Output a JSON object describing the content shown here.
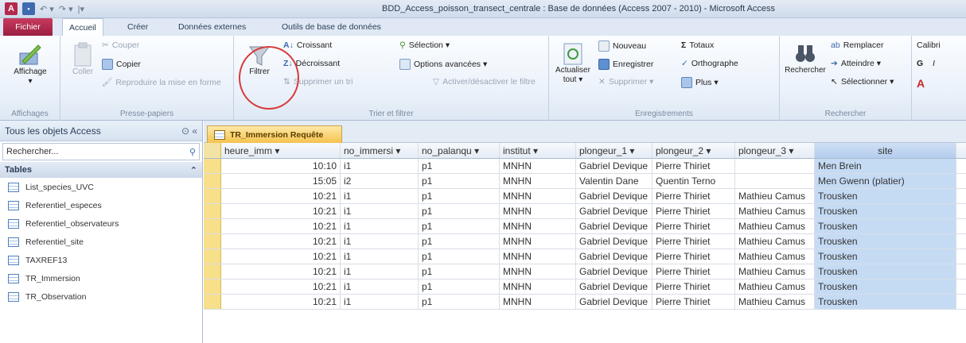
{
  "window": {
    "title": "BDD_Access_poisson_transect_centrale : Base de données (Access 2007 - 2010) - Microsoft Access"
  },
  "ribbon_tabs": [
    "Fichier",
    "Accueil",
    "Créer",
    "Données externes",
    "Outils de base de données"
  ],
  "ribbon": {
    "affichages": {
      "view_label": "Affichage",
      "group_label": "Affichages"
    },
    "clipboard": {
      "paste_label": "Coller",
      "cut_label": "Couper",
      "copy_label": "Copier",
      "format_painter_label": "Reproduire la mise en forme",
      "group_label": "Presse-papiers"
    },
    "sort_filter": {
      "filter_label": "Filtrer",
      "asc_label": "Croissant",
      "desc_label": "Décroissant",
      "remove_sort_label": "Supprimer un tri",
      "selection_label": "Sélection ▾",
      "advanced_label": "Options avancées ▾",
      "toggle_filter_label": "Activer/désactiver le filtre",
      "group_label": "Trier et filtrer"
    },
    "records": {
      "refresh_label": "Actualiser tout ▾",
      "new_label": "Nouveau",
      "save_label": "Enregistrer",
      "delete_label": "Supprimer ▾",
      "totals_label": "Totaux",
      "spelling_label": "Orthographe",
      "more_label": "Plus ▾",
      "group_label": "Enregistrements"
    },
    "find": {
      "find_label": "Rechercher",
      "replace_label": "Remplacer",
      "goto_label": "Atteindre ▾",
      "select_label": "Sélectionner ▾",
      "group_label": "Rechercher"
    },
    "font": {
      "font_name": "Calibri",
      "bold": "G",
      "italic": "I"
    }
  },
  "nav": {
    "title": "Tous les objets Access",
    "search_placeholder": "Rechercher...",
    "section": "Tables",
    "items": [
      "List_species_UVC",
      "Referentiel_especes",
      "Referentiel_observateurs",
      "Referentiel_site",
      "TAXREF13",
      "TR_Immersion",
      "TR_Observation"
    ]
  },
  "document": {
    "tab_label": "TR_Immersion Requête",
    "columns": [
      "heure_imm ▾",
      "no_immersi ▾",
      "no_palanqu ▾",
      "institut ▾",
      "plongeur_1 ▾",
      "plongeur_2 ▾",
      "plongeur_3 ▾",
      "site"
    ],
    "rows": [
      [
        "10:10",
        "i1",
        "p1",
        "MNHN",
        "Gabriel Devique",
        "Pierre Thiriet",
        "",
        "Men Brein"
      ],
      [
        "15:05",
        "i2",
        "p1",
        "MNHN",
        "Valentin Dane",
        "Quentin Terno",
        "",
        "Men Gwenn (platier)"
      ],
      [
        "10:21",
        "i1",
        "p1",
        "MNHN",
        "Gabriel Devique",
        "Pierre Thiriet",
        "Mathieu Camus",
        "Trousken"
      ],
      [
        "10:21",
        "i1",
        "p1",
        "MNHN",
        "Gabriel Devique",
        "Pierre Thiriet",
        "Mathieu Camus",
        "Trousken"
      ],
      [
        "10:21",
        "i1",
        "p1",
        "MNHN",
        "Gabriel Devique",
        "Pierre Thiriet",
        "Mathieu Camus",
        "Trousken"
      ],
      [
        "10:21",
        "i1",
        "p1",
        "MNHN",
        "Gabriel Devique",
        "Pierre Thiriet",
        "Mathieu Camus",
        "Trousken"
      ],
      [
        "10:21",
        "i1",
        "p1",
        "MNHN",
        "Gabriel Devique",
        "Pierre Thiriet",
        "Mathieu Camus",
        "Trousken"
      ],
      [
        "10:21",
        "i1",
        "p1",
        "MNHN",
        "Gabriel Devique",
        "Pierre Thiriet",
        "Mathieu Camus",
        "Trousken"
      ],
      [
        "10:21",
        "i1",
        "p1",
        "MNHN",
        "Gabriel Devique",
        "Pierre Thiriet",
        "Mathieu Camus",
        "Trousken"
      ],
      [
        "10:21",
        "i1",
        "p1",
        "MNHN",
        "Gabriel Devique",
        "Pierre Thiriet",
        "Mathieu Camus",
        "Trousken"
      ]
    ]
  },
  "colors": {
    "file_tab": "#b3294e",
    "annotation_circle": "#d83a3a",
    "selected_column": "#c5dbf4",
    "query_tab": "#f5c24e"
  }
}
